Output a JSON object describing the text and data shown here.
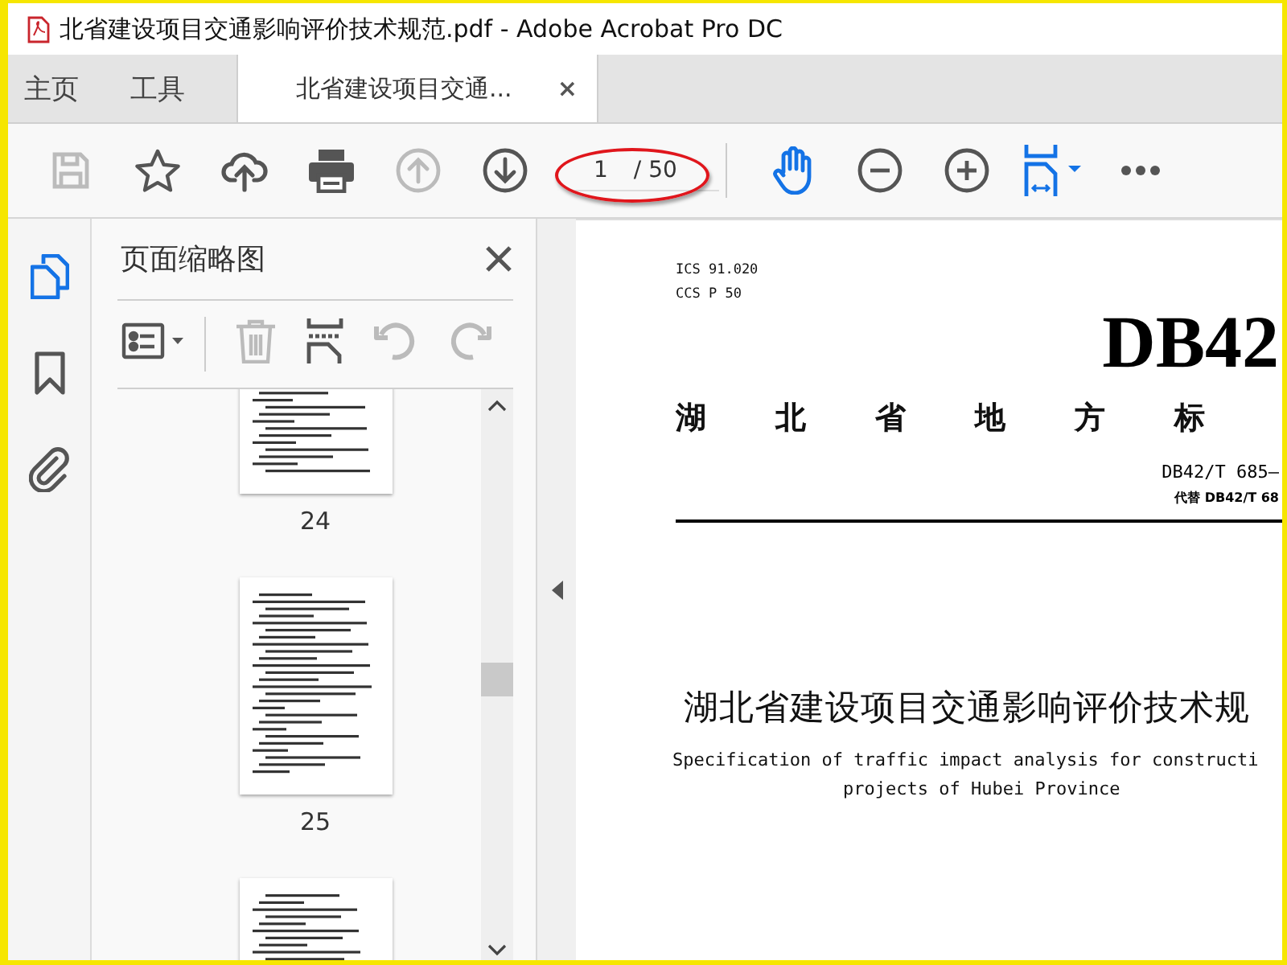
{
  "window": {
    "title": "北省建设项目交通影响评价技术规范.pdf - Adobe Acrobat Pro DC"
  },
  "tabs": [
    {
      "label": "主页",
      "kind": "nav",
      "selected": false
    },
    {
      "label": "工具",
      "kind": "nav",
      "selected": false
    },
    {
      "label": "北省建设项目交通...",
      "kind": "document",
      "selected": true,
      "close": "×"
    }
  ],
  "toolbar": {
    "left_buttons": [
      {
        "kind": "save",
        "disabled": true,
        "active": false
      },
      {
        "kind": "star",
        "disabled": false,
        "active": false
      },
      {
        "kind": "upload",
        "disabled": false,
        "active": false
      },
      {
        "kind": "print",
        "disabled": false,
        "active": false
      },
      {
        "kind": "previous",
        "disabled": true,
        "active": false
      },
      {
        "kind": "next",
        "disabled": false,
        "active": false
      }
    ],
    "page_number": "1",
    "page_count": "/ 50",
    "right_buttons": [
      {
        "kind": "hand",
        "disabled": false,
        "active": true
      },
      {
        "kind": "zoom_out",
        "disabled": false,
        "active": false
      },
      {
        "kind": "zoom_in",
        "disabled": false,
        "active": false
      },
      {
        "kind": "fit",
        "disabled": false,
        "active": true
      },
      {
        "kind": "more",
        "disabled": false,
        "active": false
      }
    ]
  },
  "rail": [
    {
      "kind": "thumbnails",
      "selected": true
    },
    {
      "kind": "bookmarks",
      "selected": false
    },
    {
      "kind": "attachments",
      "selected": false
    }
  ],
  "panel": {
    "title": "页面缩略图",
    "tools": [
      {
        "kind": "options",
        "disabled": false
      },
      {
        "kind": "delete",
        "disabled": true
      },
      {
        "kind": "insert",
        "disabled": false
      },
      {
        "kind": "rotate_left",
        "disabled": true
      },
      {
        "kind": "rotate_right",
        "disabled": true
      }
    ],
    "thumbnails": [
      {
        "kind": "page",
        "label": "24"
      },
      {
        "kind": "page",
        "label": "25"
      },
      {
        "kind": "page"
      }
    ]
  },
  "document": {
    "codes": [
      "ICS 91.020",
      "CCS P 50"
    ],
    "standard_mark": "DB42",
    "category": "湖北省地方标",
    "number": "DB42/T 685—",
    "replaces": "代替 DB42/T 68",
    "title": "湖北省建设项目交通影响评价技术规",
    "subtitle_lines": [
      "Specification of traffic impact analysis for constructi",
      "projects of Hubei Province"
    ]
  }
}
